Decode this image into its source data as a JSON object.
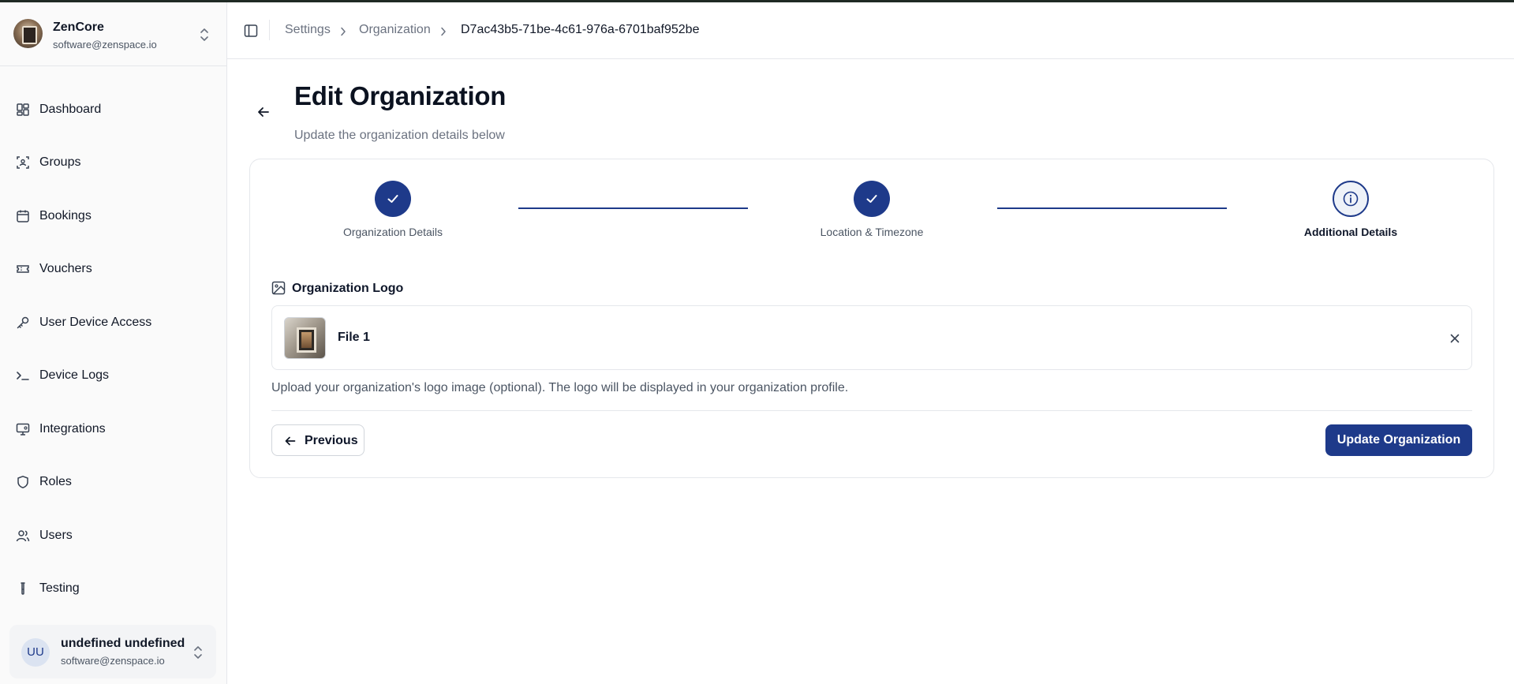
{
  "brand": {
    "name": "ZenCore",
    "email": "software@zenspace.io",
    "avatar_icon": "organization-avatar"
  },
  "sidebar": {
    "items": [
      {
        "label": "Dashboard",
        "icon": "dashboard-icon"
      },
      {
        "label": "Groups",
        "icon": "groups-icon"
      },
      {
        "label": "Bookings",
        "icon": "calendar-icon"
      },
      {
        "label": "Vouchers",
        "icon": "ticket-icon"
      },
      {
        "label": "User Device Access",
        "icon": "key-icon"
      },
      {
        "label": "Device Logs",
        "icon": "terminal-icon"
      },
      {
        "label": "Integrations",
        "icon": "monitor-icon"
      },
      {
        "label": "Roles",
        "icon": "shield-icon"
      },
      {
        "label": "Users",
        "icon": "users-icon"
      },
      {
        "label": "Testing",
        "icon": "test-tube-icon"
      }
    ]
  },
  "user": {
    "initials": "UU",
    "name": "undefined undefined",
    "email": "software@zenspace.io"
  },
  "breadcrumb": {
    "items": [
      "Settings",
      "Organization",
      "D7ac43b5-71be-4c61-976a-6701baf952be"
    ]
  },
  "page": {
    "title": "Edit Organization",
    "subtitle": "Update the organization details below"
  },
  "stepper": {
    "steps": [
      {
        "label": "Organization Details",
        "status": "complete"
      },
      {
        "label": "Location & Timezone",
        "status": "complete"
      },
      {
        "label": "Additional Details",
        "status": "active"
      }
    ]
  },
  "logo_section": {
    "title": "Organization Logo",
    "file_name": "File 1",
    "help_text": "Upload your organization's logo image (optional). The logo will be displayed in your organization profile."
  },
  "actions": {
    "previous_label": "Previous",
    "submit_label": "Update Organization"
  },
  "colors": {
    "primary": "#1e3a8a",
    "sidebar_bg": "#fafafa",
    "border": "#e5e7eb",
    "muted_text": "#6b7280"
  }
}
